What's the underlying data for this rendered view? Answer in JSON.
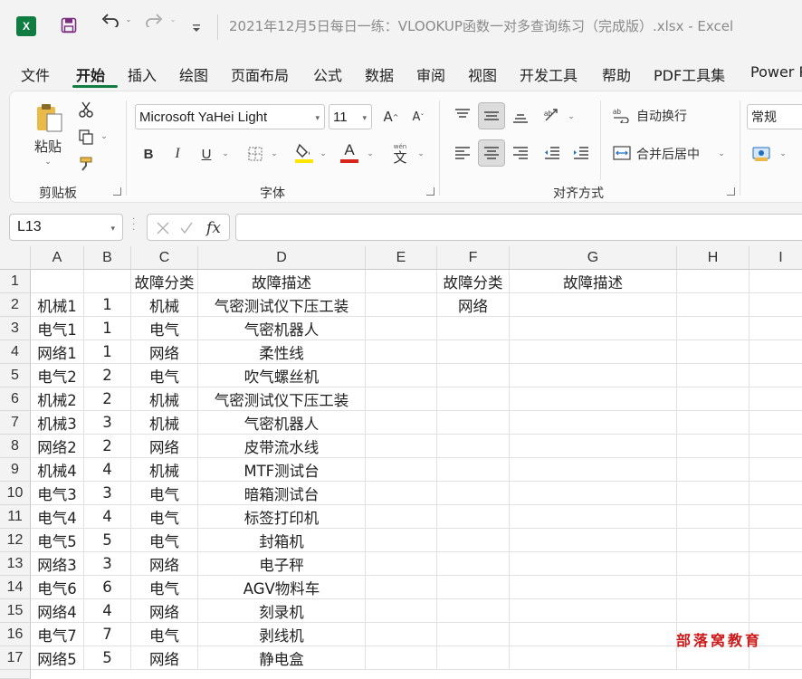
{
  "titlebar": {
    "app_icon": "X",
    "title": "2021年12月5日每日一练：VLOOKUP函数一对多查询练习（完成版）.xlsx  -  Excel",
    "icons": [
      "excel-icon",
      "save-icon",
      "undo-icon",
      "redo-icon",
      "customize-qat-icon"
    ]
  },
  "menu": {
    "tabs": [
      "文件",
      "开始",
      "插入",
      "绘图",
      "页面布局",
      "公式",
      "数据",
      "审阅",
      "视图",
      "开发工具",
      "帮助",
      "PDF工具集",
      "Power Pivot"
    ],
    "active": "开始"
  },
  "ribbon": {
    "clipboard": {
      "paste_label": "粘贴",
      "group_label": "剪贴板"
    },
    "font": {
      "font_name": "Microsoft YaHei Light",
      "font_size": "11",
      "bold": "B",
      "italic": "I",
      "underline": "U",
      "font_color_glyph": "A",
      "phonetic_glyph": "文",
      "group_label": "字体",
      "accent_colors": {
        "fill": "#ffe600",
        "font": "#d9261c"
      }
    },
    "alignment": {
      "wrap_text": "自动换行",
      "merge_center": "合并后居中",
      "group_label": "对齐方式"
    },
    "number": {
      "format": "常规"
    }
  },
  "formula_bar": {
    "name_box": "L13",
    "fx": "fx",
    "formula": ""
  },
  "sheet": {
    "columns": [
      "A",
      "B",
      "C",
      "D",
      "E",
      "F",
      "G",
      "H",
      "I"
    ],
    "rows": [
      [
        "",
        "",
        "故障分类",
        "故障描述",
        "",
        "故障分类",
        "故障描述",
        "",
        ""
      ],
      [
        "机械1",
        "1",
        "机械",
        "气密测试仪下压工装",
        "",
        "网络",
        "",
        "",
        ""
      ],
      [
        "电气1",
        "1",
        "电气",
        "气密机器人",
        "",
        "",
        "",
        "",
        ""
      ],
      [
        "网络1",
        "1",
        "网络",
        "柔性线",
        "",
        "",
        "",
        "",
        ""
      ],
      [
        "电气2",
        "2",
        "电气",
        "吹气螺丝机",
        "",
        "",
        "",
        "",
        ""
      ],
      [
        "机械2",
        "2",
        "机械",
        "气密测试仪下压工装",
        "",
        "",
        "",
        "",
        ""
      ],
      [
        "机械3",
        "3",
        "机械",
        "气密机器人",
        "",
        "",
        "",
        "",
        ""
      ],
      [
        "网络2",
        "2",
        "网络",
        "皮带流水线",
        "",
        "",
        "",
        "",
        ""
      ],
      [
        "机械4",
        "4",
        "机械",
        "MTF测试台",
        "",
        "",
        "",
        "",
        ""
      ],
      [
        "电气3",
        "3",
        "电气",
        "暗箱测试台",
        "",
        "",
        "",
        "",
        ""
      ],
      [
        "电气4",
        "4",
        "电气",
        "标签打印机",
        "",
        "",
        "",
        "",
        ""
      ],
      [
        "电气5",
        "5",
        "电气",
        "封箱机",
        "",
        "",
        "",
        "",
        ""
      ],
      [
        "网络3",
        "3",
        "网络",
        "电子秤",
        "",
        "",
        "",
        "",
        ""
      ],
      [
        "电气6",
        "6",
        "电气",
        "AGV物料车",
        "",
        "",
        "",
        "",
        ""
      ],
      [
        "网络4",
        "4",
        "网络",
        "刻录机",
        "",
        "",
        "",
        "",
        ""
      ],
      [
        "电气7",
        "7",
        "电气",
        "剥线机",
        "",
        "",
        "",
        "",
        ""
      ],
      [
        "网络5",
        "5",
        "网络",
        "静电盒",
        "",
        "",
        "",
        "",
        ""
      ]
    ]
  },
  "watermark": "部落窝教育"
}
